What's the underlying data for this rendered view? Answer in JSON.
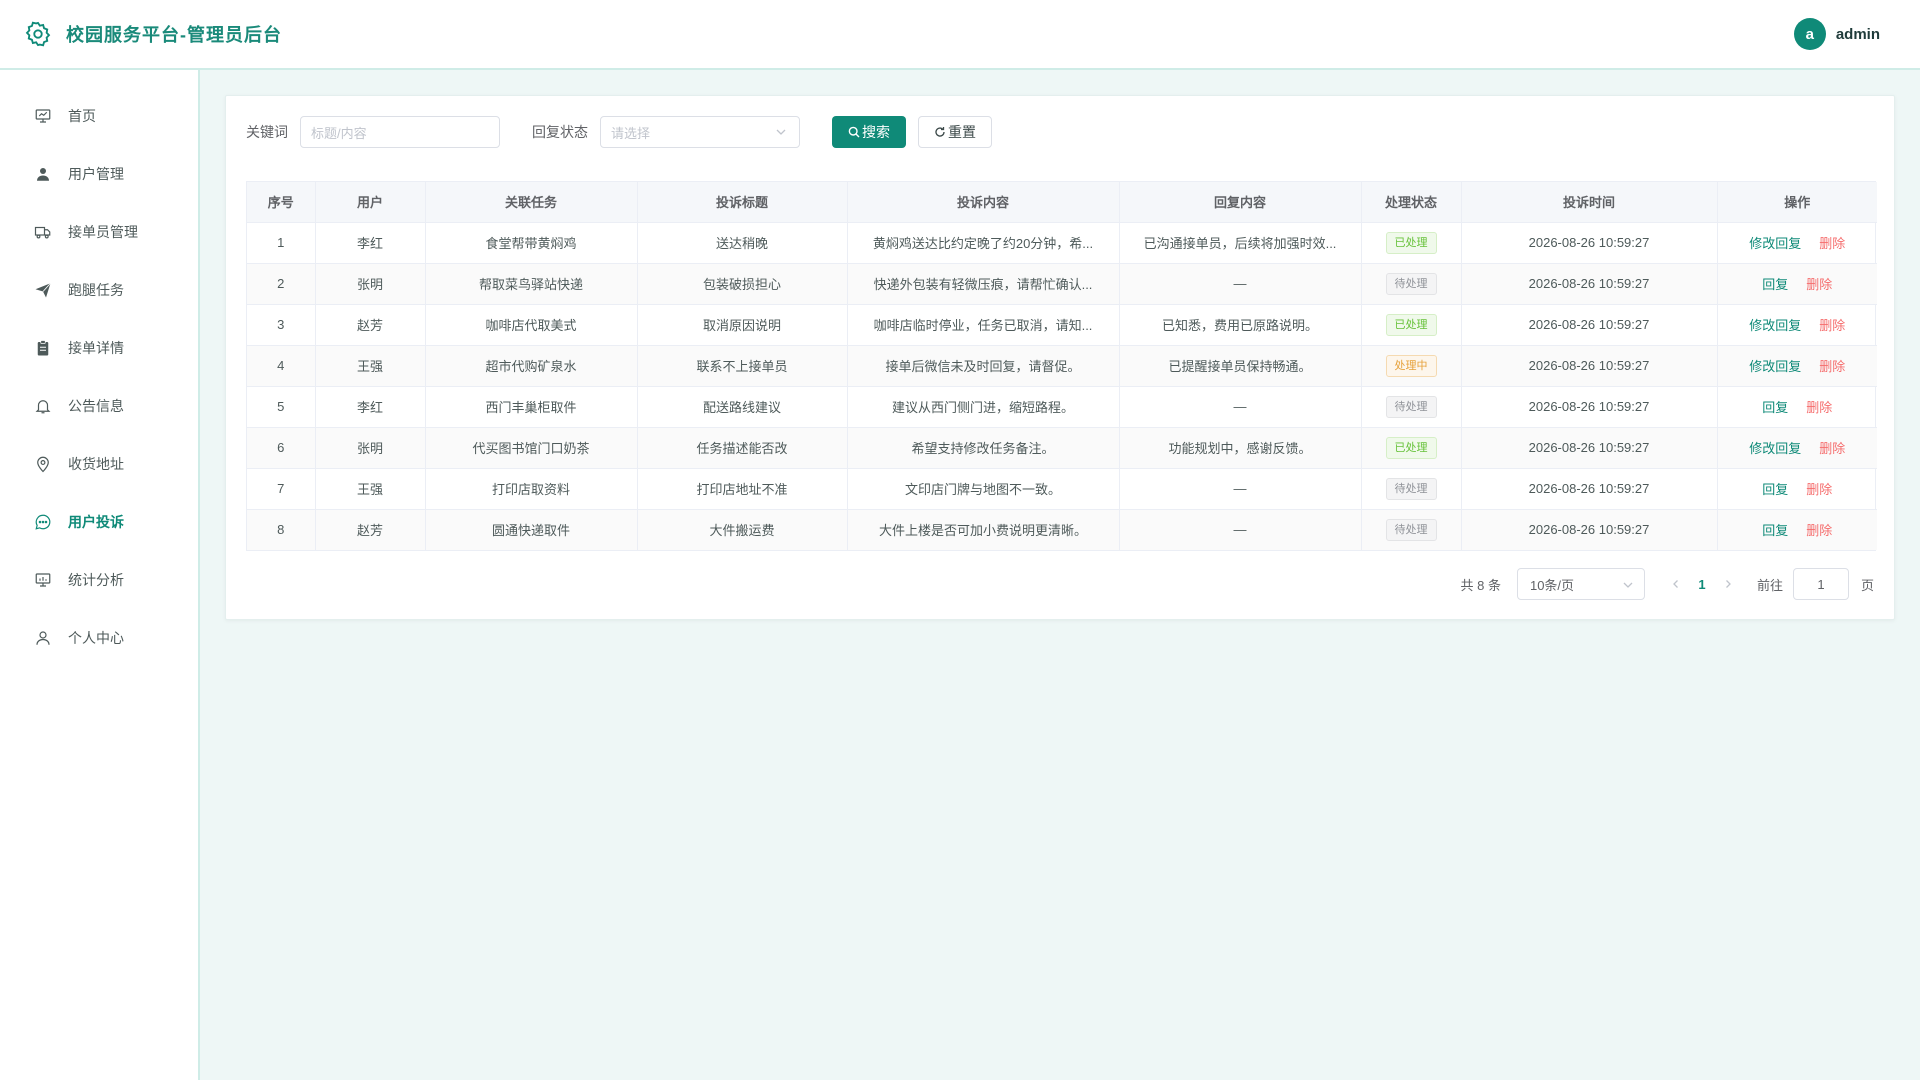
{
  "header": {
    "title": "校园服务平台-管理员后台",
    "user": {
      "avatar_letter": "a",
      "name": "admin"
    }
  },
  "sidebar": {
    "items": [
      {
        "label": "首页",
        "icon": "monitor-icon"
      },
      {
        "label": "用户管理",
        "icon": "user-icon"
      },
      {
        "label": "接单员管理",
        "icon": "truck-icon"
      },
      {
        "label": "跑腿任务",
        "icon": "paper-plane-icon"
      },
      {
        "label": "接单详情",
        "icon": "clipboard-icon"
      },
      {
        "label": "公告信息",
        "icon": "bell-icon"
      },
      {
        "label": "收货地址",
        "icon": "location-icon"
      },
      {
        "label": "用户投诉",
        "icon": "chat-icon",
        "active": true
      },
      {
        "label": "统计分析",
        "icon": "chart-icon"
      },
      {
        "label": "个人中心",
        "icon": "profile-icon"
      }
    ]
  },
  "filters": {
    "keyword_label": "关键词",
    "keyword_placeholder": "标题/内容",
    "status_label": "回复状态",
    "status_placeholder": "请选择",
    "search_label": "搜索",
    "reset_label": "重置"
  },
  "table": {
    "columns": [
      "序号",
      "用户",
      "关联任务",
      "投诉标题",
      "投诉内容",
      "回复内容",
      "处理状态",
      "投诉时间",
      "操作"
    ],
    "rows": [
      {
        "no": "1",
        "user": "李红",
        "task": "食堂帮带黄焖鸡",
        "title": "送达稍晚",
        "content": "黄焖鸡送达比约定晚了约20分钟，希...",
        "reply": "已沟通接单员，后续将加强时效...",
        "status": "已处理",
        "status_type": "done",
        "time": "2026-08-26 10:59:27",
        "edit_label": "修改回复",
        "delete_label": "删除"
      },
      {
        "no": "2",
        "user": "张明",
        "task": "帮取菜鸟驿站快递",
        "title": "包装破损担心",
        "content": "快递外包装有轻微压痕，请帮忙确认...",
        "reply": "—",
        "status": "待处理",
        "status_type": "pending",
        "time": "2026-08-26 10:59:27",
        "edit_label": "回复",
        "delete_label": "删除"
      },
      {
        "no": "3",
        "user": "赵芳",
        "task": "咖啡店代取美式",
        "title": "取消原因说明",
        "content": "咖啡店临时停业，任务已取消，请知...",
        "reply": "已知悉，费用已原路说明。",
        "status": "已处理",
        "status_type": "done",
        "time": "2026-08-26 10:59:27",
        "edit_label": "修改回复",
        "delete_label": "删除"
      },
      {
        "no": "4",
        "user": "王强",
        "task": "超市代购矿泉水",
        "title": "联系不上接单员",
        "content": "接单后微信未及时回复，请督促。",
        "reply": "已提醒接单员保持畅通。",
        "status": "处理中",
        "status_type": "processing",
        "time": "2026-08-26 10:59:27",
        "edit_label": "修改回复",
        "delete_label": "删除"
      },
      {
        "no": "5",
        "user": "李红",
        "task": "西门丰巢柜取件",
        "title": "配送路线建议",
        "content": "建议从西门侧门进，缩短路程。",
        "reply": "—",
        "status": "待处理",
        "status_type": "pending",
        "time": "2026-08-26 10:59:27",
        "edit_label": "回复",
        "delete_label": "删除"
      },
      {
        "no": "6",
        "user": "张明",
        "task": "代买图书馆门口奶茶",
        "title": "任务描述能否改",
        "content": "希望支持修改任务备注。",
        "reply": "功能规划中，感谢反馈。",
        "status": "已处理",
        "status_type": "done",
        "time": "2026-08-26 10:59:27",
        "edit_label": "修改回复",
        "delete_label": "删除"
      },
      {
        "no": "7",
        "user": "王强",
        "task": "打印店取资料",
        "title": "打印店地址不准",
        "content": "文印店门牌与地图不一致。",
        "reply": "—",
        "status": "待处理",
        "status_type": "pending",
        "time": "2026-08-26 10:59:27",
        "edit_label": "回复",
        "delete_label": "删除"
      },
      {
        "no": "8",
        "user": "赵芳",
        "task": "圆通快递取件",
        "title": "大件搬运费",
        "content": "大件上楼是否可加小费说明更清晰。",
        "reply": "—",
        "status": "待处理",
        "status_type": "pending",
        "time": "2026-08-26 10:59:27",
        "edit_label": "回复",
        "delete_label": "删除"
      }
    ]
  },
  "pagination": {
    "total_text": "共 8 条",
    "page_size": "10条/页",
    "current_page": "1",
    "goto_label": "前往",
    "goto_value": "1",
    "unit_label": "页"
  },
  "colors": {
    "primary": "#0f8a78",
    "danger": "#f56c6c",
    "status_done": "#67c23a",
    "status_pending": "#909399",
    "status_processing": "#e6a23c"
  }
}
